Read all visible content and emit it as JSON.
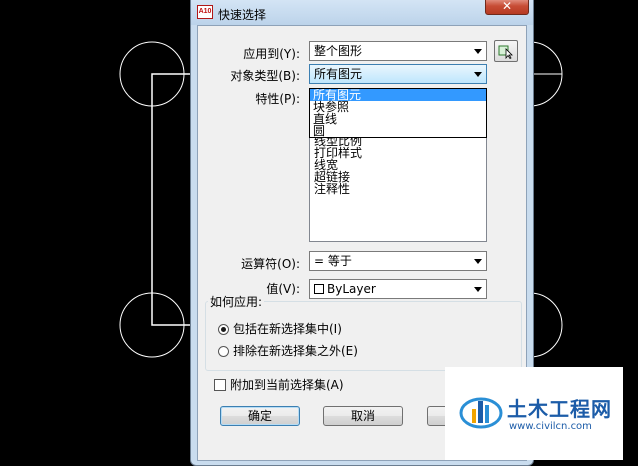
{
  "dialog": {
    "title": "快速选择",
    "app_icon_text": "A10",
    "close_label": "✕"
  },
  "form": {
    "apply_to": {
      "label": "应用到(Y):",
      "value": "整个图形"
    },
    "object_type": {
      "label": "对象类型(B):",
      "value": "所有图元"
    },
    "properties": {
      "label": "特性(P):",
      "items": [
        "线型比例",
        "打印样式",
        "线宽",
        "超链接",
        "注释性"
      ]
    },
    "object_type_dropdown": {
      "options": [
        "所有图元",
        "块参照",
        "直线",
        "圆"
      ],
      "selected_index": 0
    },
    "operator": {
      "label": "运算符(O):",
      "value": "= 等于"
    },
    "value": {
      "label": "值(V):",
      "value": "ByLayer"
    }
  },
  "how_to_apply": {
    "title": "如何应用:",
    "include": "包括在新选择集中(I)",
    "exclude": "排除在新选择集之外(E)",
    "selected": "include"
  },
  "append": {
    "label": "附加到当前选择集(A)",
    "checked": false
  },
  "buttons": {
    "ok": "确定",
    "cancel": "取消"
  },
  "watermark": {
    "title": "土木工程网",
    "url": "www.civilcn.com"
  },
  "colors": {
    "titlebar": "#c9dcee",
    "selection": "#3399ff",
    "close": "#c74c35",
    "brand": "#1c5ca8"
  }
}
